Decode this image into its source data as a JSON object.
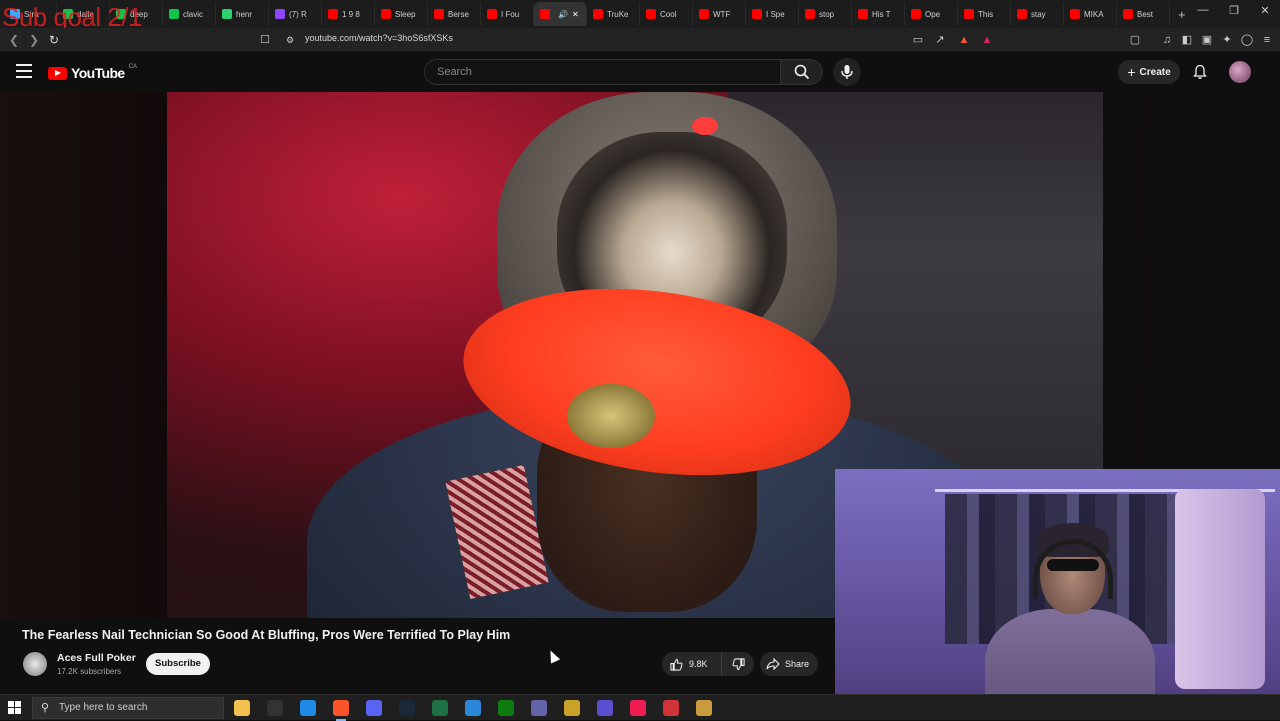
{
  "overlay": {
    "subgoal_text": "Sub goal 2/1"
  },
  "browser": {
    "tabs": [
      {
        "label": "Stra",
        "icon": "#3ea6ff"
      },
      {
        "label": "dalle",
        "icon": "#10c44c"
      },
      {
        "label": "deep",
        "icon": "#10c44c"
      },
      {
        "label": "clavic",
        "icon": "#10c44c"
      },
      {
        "label": "henr",
        "icon": "#2dd36f"
      },
      {
        "label": "(7) R",
        "icon": "#9146ff"
      },
      {
        "label": "1 9 8",
        "icon": "#ff0000"
      },
      {
        "label": "Sleep",
        "icon": "#ff0000"
      },
      {
        "label": "Berse",
        "icon": "#ff0000"
      },
      {
        "label": "I Fou",
        "icon": "#ff0000"
      },
      {
        "label": "",
        "icon": "#ff0000",
        "active": true
      },
      {
        "label": "TruKe",
        "icon": "#ff0000"
      },
      {
        "label": "Cool",
        "icon": "#ff0000"
      },
      {
        "label": "WTF",
        "icon": "#ff0000"
      },
      {
        "label": "I Spe",
        "icon": "#ff0000"
      },
      {
        "label": "stop",
        "icon": "#ff0000"
      },
      {
        "label": "His T",
        "icon": "#ff0000"
      },
      {
        "label": "Ope",
        "icon": "#ff0000"
      },
      {
        "label": "This",
        "icon": "#ff0000"
      },
      {
        "label": "stay",
        "icon": "#ff0000"
      },
      {
        "label": "MIKA",
        "icon": "#ff0000"
      },
      {
        "label": "Best",
        "icon": "#ff0000"
      }
    ],
    "new_tab_label": "+",
    "url": "youtube.com/watch?v=3hoS6sfXSKs"
  },
  "youtube": {
    "logo_text": "YouTube",
    "country_code": "CA",
    "search_placeholder": "Search",
    "create_label": "Create",
    "video_title": "The Fearless Nail Technician So Good At Bluffing, Pros Were Terrified To Play Him",
    "channel_name": "Aces Full Poker",
    "subscribers": "17.2K subscribers",
    "subscribe_label": "Subscribe",
    "likes": "9.8K",
    "share_label": "Share"
  },
  "taskbar": {
    "search_placeholder": "Type here to search",
    "apps": [
      {
        "name": "file-explorer-icon",
        "color": "#f2c14e"
      },
      {
        "name": "epic-games-icon",
        "color": "#333"
      },
      {
        "name": "edge-icon",
        "color": "#1e88e5"
      },
      {
        "name": "brave-icon",
        "color": "#fb542b",
        "active": true
      },
      {
        "name": "discord-icon",
        "color": "#5865f2"
      },
      {
        "name": "steam-icon",
        "color": "#1b2838"
      },
      {
        "name": "spreadsheet-icon",
        "color": "#1e7145"
      },
      {
        "name": "app-icon",
        "color": "#2b88d8"
      },
      {
        "name": "xbox-icon",
        "color": "#107c10"
      },
      {
        "name": "shield-icon",
        "color": "#6264a7"
      },
      {
        "name": "stats-icon",
        "color": "#c9a227"
      },
      {
        "name": "messenger-icon",
        "color": "#5a4fcf"
      },
      {
        "name": "tiktok-icon",
        "color": "#ee1d52"
      },
      {
        "name": "hub-icon",
        "color": "#d13438"
      },
      {
        "name": "lol-icon",
        "color": "#c89b3c"
      }
    ]
  }
}
